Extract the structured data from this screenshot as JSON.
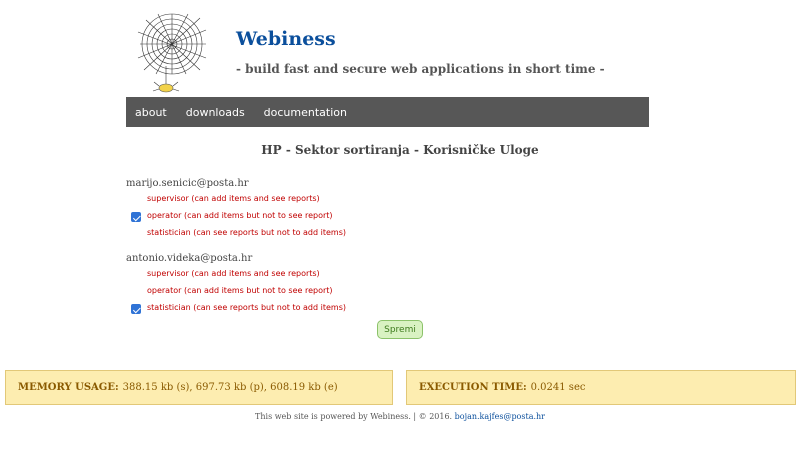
{
  "header": {
    "title": "Webiness",
    "tagline": "- build fast and secure web applications in short time -"
  },
  "nav": {
    "items": [
      {
        "label": "about"
      },
      {
        "label": "downloads"
      },
      {
        "label": "documentation"
      }
    ]
  },
  "page": {
    "title": "HP - Sektor sortiranja - Korisničke Uloge"
  },
  "users": [
    {
      "email": "marijo.senicic@posta.hr",
      "roles": [
        {
          "label": "supervisor (can add items and see reports)",
          "checked": false
        },
        {
          "label": "operator (can add items but not to see report)",
          "checked": true
        },
        {
          "label": "statistician (can see reports but not to add items)",
          "checked": false
        }
      ]
    },
    {
      "email": "antonio.videka@posta.hr",
      "roles": [
        {
          "label": "supervisor (can add items and see reports)",
          "checked": false
        },
        {
          "label": "operator (can add items but not to see report)",
          "checked": false
        },
        {
          "label": "statistician (can see reports but not to add items)",
          "checked": true
        }
      ]
    }
  ],
  "form": {
    "save_label": "Spremi"
  },
  "stats": {
    "memory_label": "MEMORY USAGE:",
    "memory_value": "388.15 kb (s), 697.73 kb (p), 608.19 kb (e)",
    "exec_label": "EXECUTION TIME:",
    "exec_value": "0.0241 sec"
  },
  "footer": {
    "text": "This web site is powered by Webiness. | © 2016.",
    "email": "bojan.kajfes@posta.hr"
  },
  "colors": {
    "accent": "#0b4f9c",
    "nav_bg": "#575757",
    "role_text": "#c00000",
    "stat_bg": "#fdedb0",
    "save_bg": "#d9f2c2"
  }
}
